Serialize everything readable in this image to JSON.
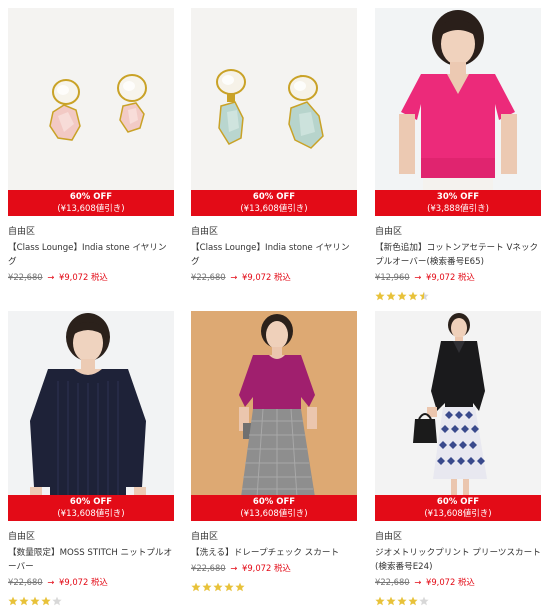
{
  "products": [
    {
      "brand": "自由区",
      "name": "【Class Lounge】India stone イヤリング",
      "badge_percent": "60% OFF",
      "badge_discount": "(¥13,608値引き)",
      "old_price": "¥22,680",
      "arrow": "→",
      "new_price": "¥9,072 税込",
      "rating": 0
    },
    {
      "brand": "自由区",
      "name": "【Class Lounge】India stone イヤリング",
      "badge_percent": "60% OFF",
      "badge_discount": "(¥13,608値引き)",
      "old_price": "¥22,680",
      "arrow": "→",
      "new_price": "¥9,072 税込",
      "rating": 0
    },
    {
      "brand": "自由区",
      "name": "【新色追加】コットンアセテート Vネックプルオーバー(検索番号E65)",
      "badge_percent": "30% OFF",
      "badge_discount": "(¥3,888値引き)",
      "old_price": "¥12,960",
      "arrow": "→",
      "new_price": "¥9,072 税込",
      "rating": 4.5
    },
    {
      "brand": "自由区",
      "name": "【数量限定】MOSS STITCH ニットプルオーバー",
      "badge_percent": "60% OFF",
      "badge_discount": "(¥13,608値引き)",
      "old_price": "¥22,680",
      "arrow": "→",
      "new_price": "¥9,072 税込",
      "rating": 4
    },
    {
      "brand": "自由区",
      "name": "【洗える】ドレープチェック スカート",
      "badge_percent": "60% OFF",
      "badge_discount": "(¥13,608値引き)",
      "old_price": "¥22,680",
      "arrow": "→",
      "new_price": "¥9,072 税込",
      "rating": 5
    },
    {
      "brand": "自由区",
      "name": "ジオメトリックプリント プリーツスカート(検索番号E24)",
      "badge_percent": "60% OFF",
      "badge_discount": "(¥13,608値引き)",
      "old_price": "¥22,680",
      "arrow": "→",
      "new_price": "¥9,072 税込",
      "rating": 4
    }
  ],
  "colors": {
    "sale_red": "#e30b17",
    "star_gold": "#e8c23a",
    "star_empty": "#d8d8d8"
  },
  "icons": [
    "earring-pearl-pink-image",
    "earring-pearl-green-image",
    "model-pink-top-image",
    "model-navy-knit-image",
    "model-check-skirt-image",
    "model-geometric-skirt-image",
    "star-icon"
  ]
}
